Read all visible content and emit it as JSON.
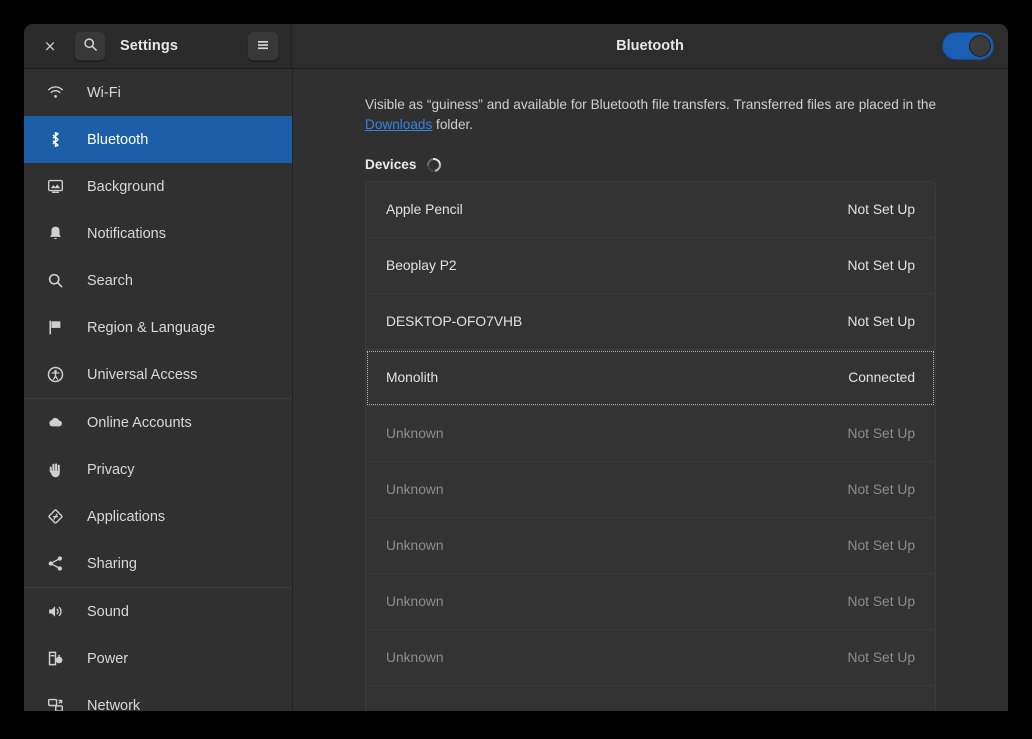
{
  "header": {
    "close_label": "×",
    "close_icon": "close-icon",
    "search_icon": "search-icon",
    "app_title": "Settings",
    "menu_icon": "hamburger-menu-icon",
    "page_title": "Bluetooth",
    "toggle_state": "on"
  },
  "sidebar": {
    "items": [
      {
        "label": "Wi-Fi",
        "icon": "wifi-icon",
        "selected": false,
        "separator_after": false
      },
      {
        "label": "Bluetooth",
        "icon": "bluetooth-icon",
        "selected": true,
        "separator_after": false
      },
      {
        "label": "Background",
        "icon": "background-icon",
        "selected": false,
        "separator_after": false
      },
      {
        "label": "Notifications",
        "icon": "bell-icon",
        "selected": false,
        "separator_after": false
      },
      {
        "label": "Search",
        "icon": "search-icon",
        "selected": false,
        "separator_after": false
      },
      {
        "label": "Region & Language",
        "icon": "flag-icon",
        "selected": false,
        "separator_after": false
      },
      {
        "label": "Universal Access",
        "icon": "accessibility-icon",
        "selected": false,
        "separator_after": true
      },
      {
        "label": "Online Accounts",
        "icon": "cloud-icon",
        "selected": false,
        "separator_after": false
      },
      {
        "label": "Privacy",
        "icon": "hand-icon",
        "selected": false,
        "separator_after": false
      },
      {
        "label": "Applications",
        "icon": "applications-icon",
        "selected": false,
        "separator_after": false
      },
      {
        "label": "Sharing",
        "icon": "share-icon",
        "selected": false,
        "separator_after": true
      },
      {
        "label": "Sound",
        "icon": "speaker-icon",
        "selected": false,
        "separator_after": false
      },
      {
        "label": "Power",
        "icon": "power-battery-icon",
        "selected": false,
        "separator_after": false
      },
      {
        "label": "Network",
        "icon": "network-icon",
        "selected": false,
        "separator_after": false
      }
    ]
  },
  "main": {
    "description": {
      "before_link": "Visible as “guiness” and available for Bluetooth file transfers. Transferred files are placed in the ",
      "link_text": "Downloads",
      "after_link": " folder."
    },
    "devices_label": "Devices",
    "spinner_icon": "loading-spinner-icon",
    "devices": [
      {
        "name": "Apple Pencil",
        "status": "Not Set Up",
        "dim": false,
        "focused": false
      },
      {
        "name": "Beoplay P2",
        "status": "Not Set Up",
        "dim": false,
        "focused": false
      },
      {
        "name": "DESKTOP-OFO7VHB",
        "status": "Not Set Up",
        "dim": false,
        "focused": false
      },
      {
        "name": "Monolith",
        "status": "Connected",
        "dim": false,
        "focused": true
      },
      {
        "name": "Unknown",
        "status": "Not Set Up",
        "dim": true,
        "focused": false
      },
      {
        "name": "Unknown",
        "status": "Not Set Up",
        "dim": true,
        "focused": false
      },
      {
        "name": "Unknown",
        "status": "Not Set Up",
        "dim": true,
        "focused": false
      },
      {
        "name": "Unknown",
        "status": "Not Set Up",
        "dim": true,
        "focused": false
      },
      {
        "name": "Unknown",
        "status": "Not Set Up",
        "dim": true,
        "focused": false
      },
      {
        "name": "",
        "status": "",
        "dim": true,
        "focused": false
      }
    ]
  },
  "colors": {
    "accent": "#1c5fa8",
    "link": "#3584e4",
    "window_bg": "#303030",
    "header_bg": "#2b2b2b"
  }
}
